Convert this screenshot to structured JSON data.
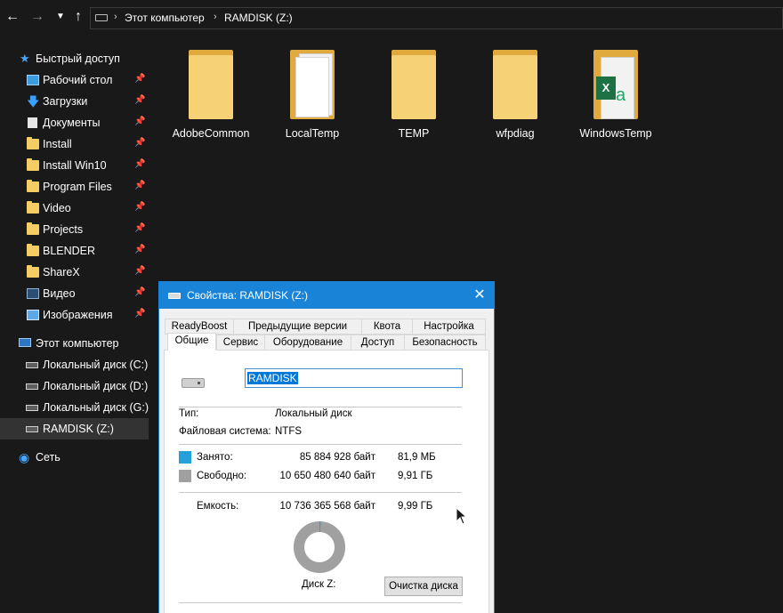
{
  "address": {
    "crumbs": [
      "Этот компьютер",
      "RAMDISK (Z:)"
    ]
  },
  "sidebar": {
    "quick_access": "Быстрый доступ",
    "quick_items": [
      {
        "label": "Рабочий стол",
        "icon": "desktop-icon"
      },
      {
        "label": "Загрузки",
        "icon": "download-icon"
      },
      {
        "label": "Документы",
        "icon": "documents-icon"
      },
      {
        "label": "Install",
        "icon": "folder-icon"
      },
      {
        "label": "Install Win10",
        "icon": "folder-icon"
      },
      {
        "label": "Program Files",
        "icon": "folder-icon"
      },
      {
        "label": "Video",
        "icon": "folder-icon"
      },
      {
        "label": "Projects",
        "icon": "folder-icon"
      },
      {
        "label": "BLENDER",
        "icon": "folder-icon"
      },
      {
        "label": "ShareX",
        "icon": "folder-icon"
      },
      {
        "label": "Видео",
        "icon": "video-icon"
      },
      {
        "label": "Изображения",
        "icon": "pictures-icon"
      }
    ],
    "this_pc": "Этот компьютер",
    "drives": [
      {
        "label": "Локальный диск (C:)"
      },
      {
        "label": "Локальный диск (D:)"
      },
      {
        "label": "Локальный диск (G:)"
      },
      {
        "label": "RAMDISK (Z:)"
      }
    ],
    "network": "Сеть"
  },
  "folders": [
    {
      "name": "AdobeCommon",
      "type": "plain"
    },
    {
      "name": "LocalTemp",
      "type": "papers"
    },
    {
      "name": "TEMP",
      "type": "plain"
    },
    {
      "name": "wfpdiag",
      "type": "plain"
    },
    {
      "name": "WindowsTemp",
      "type": "excel"
    }
  ],
  "dialog": {
    "title": "Свойства: RAMDISK (Z:)",
    "tabs_top": [
      "ReadyBoost",
      "Предыдущие версии",
      "Квота",
      "Настройка"
    ],
    "tabs_bottom": [
      "Общие",
      "Сервис",
      "Оборудование",
      "Доступ",
      "Безопасность"
    ],
    "active_tab": "Общие",
    "name_value": "RAMDISK",
    "type_label": "Тип:",
    "type_value": "Локальный диск",
    "fs_label": "Файловая система:",
    "fs_value": "NTFS",
    "used_label": "Занято:",
    "used_bytes": "85 884 928 байт",
    "used_size": "81,9 МБ",
    "free_label": "Свободно:",
    "free_bytes": "10 650 480 640 байт",
    "free_size": "9,91 ГБ",
    "capacity_label": "Емкость:",
    "capacity_bytes": "10 736 365 568 байт",
    "capacity_size": "9,99 ГБ",
    "disk_label": "Диск Z:",
    "cleanup_button": "Очистка диска",
    "used_fraction": 0.008,
    "colors": {
      "used": "#26a0da",
      "free": "#a0a0a0"
    }
  }
}
